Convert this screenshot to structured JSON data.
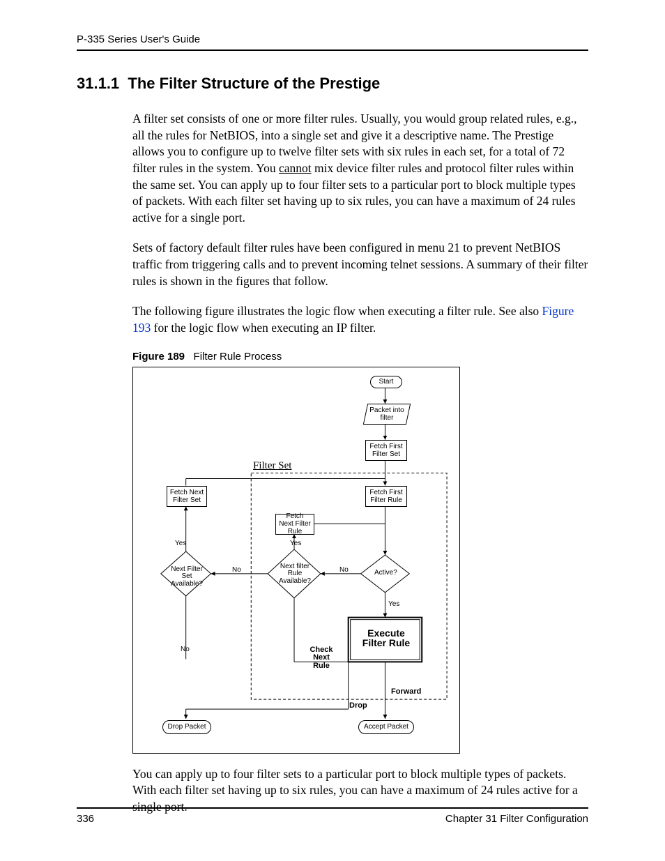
{
  "header": {
    "running": "P-335 Series User's Guide"
  },
  "section": {
    "number": "31.1.1",
    "title": "The Filter Structure of the Prestige"
  },
  "paragraphs": {
    "p1a": "A filter set consists of one or more filter rules. Usually, you would group related rules, e.g., all the rules for NetBIOS, into a single set and give it a descriptive name. The Prestige allows you to configure up to twelve filter sets with six rules in each set, for a total of 72 filter rules in the system. You ",
    "p1_cannot": "cannot",
    "p1b": " mix device filter rules and protocol filter rules within the same set. You can apply up to four filter sets to a particular port to block multiple types of packets. With each filter set having up to six rules, you can have a maximum of 24 rules active for a single port.",
    "p2": "Sets of factory default filter rules have been configured in menu 21 to prevent NetBIOS traffic from triggering calls and to prevent incoming telnet sessions. A summary of their filter rules is shown in the figures that follow.",
    "p3a": "The following figure illustrates the logic flow when executing a filter rule. See also  ",
    "p3_link": "Figure 193",
    "p3b": "  for the logic flow when executing an IP filter.",
    "p4": "You can apply up to four filter sets to a particular port to block multiple types of packets. With each filter set having up to six rules, you can have a maximum of 24 rules active for a single port."
  },
  "figure": {
    "label": "Figure 189",
    "caption": "Filter Rule Process",
    "nodes": {
      "start": "Start",
      "packet_into_filter": "Packet into filter",
      "fetch_first_set": "Fetch First Filter Set",
      "filter_set_title": "Filter Set",
      "fetch_next_set": "Fetch Next Filter Set",
      "fetch_first_rule": "Fetch First Filter Rule",
      "fetch_next_rule": "Fetch Next Filter Rule",
      "next_rule_avail": "Next filter Rule Available?",
      "active": "Active?",
      "next_set_avail": "Next Filter Set Available?",
      "execute": "Execute Filter Rule",
      "check_next": "Check Next Rule",
      "forward": "Forward",
      "drop": "Drop",
      "drop_packet": "Drop Packet",
      "accept_packet": "Accept Packet"
    },
    "edges": {
      "yes": "Yes",
      "no": "No"
    }
  },
  "footer": {
    "page": "336",
    "chapter": "Chapter 31 Filter Configuration"
  }
}
